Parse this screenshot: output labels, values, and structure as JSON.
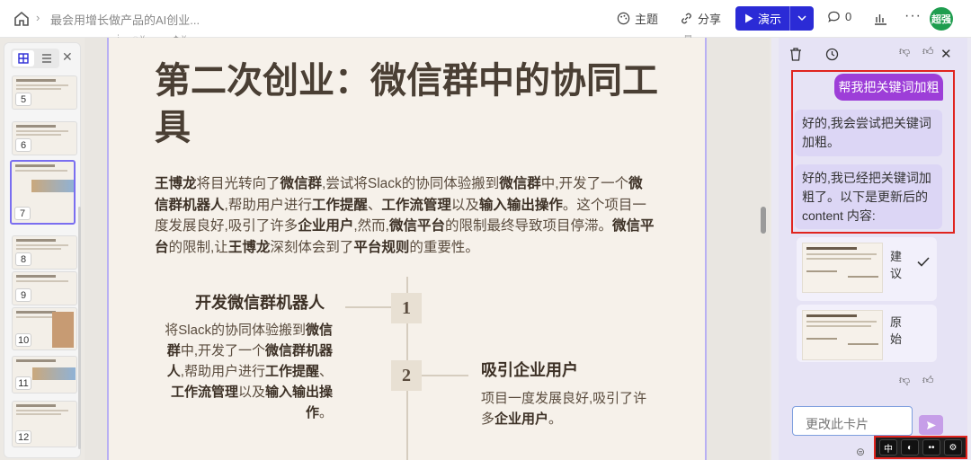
{
  "topbar": {
    "breadcrumb": "最会用增长做产品的AI创业...",
    "theme_label": "主题",
    "share_label": "分享",
    "present_label": "演示",
    "comment_count": "0",
    "avatar_text": "超强"
  },
  "sidebar": {
    "slides": [
      {
        "num": "5"
      },
      {
        "num": "6"
      },
      {
        "num": "7"
      },
      {
        "num": "8"
      },
      {
        "num": "9"
      },
      {
        "num": "10"
      },
      {
        "num": "11"
      },
      {
        "num": "12"
      }
    ]
  },
  "slide": {
    "title": "第二次创业：微信群中的协同工具",
    "col1_number": "1",
    "col1_title": "开发微信群机器人",
    "col2_number": "2",
    "col2_title": "吸引企业用户"
  },
  "chat": {
    "user_message": "帮我把关键词加粗",
    "ai_message_1": "好的,我会尝试把关键词加粗。",
    "ai_message_2": "好的,我已经把关键词加粗了。以下是更新后的content 内容:",
    "card1_label": "建议",
    "card2_label": "原始",
    "card_thumb_title": "次创业：微信群中的协同工具",
    "input_placeholder": "更改此卡片"
  },
  "bottom_tools": [
    "中",
    "◐",
    "••",
    "⚙"
  ],
  "colors": {
    "accent": "#2b2bd6",
    "user_bubble": "#9d3ed8",
    "highlight_border": "#e0241f",
    "avatar": "#1f9d4f"
  }
}
